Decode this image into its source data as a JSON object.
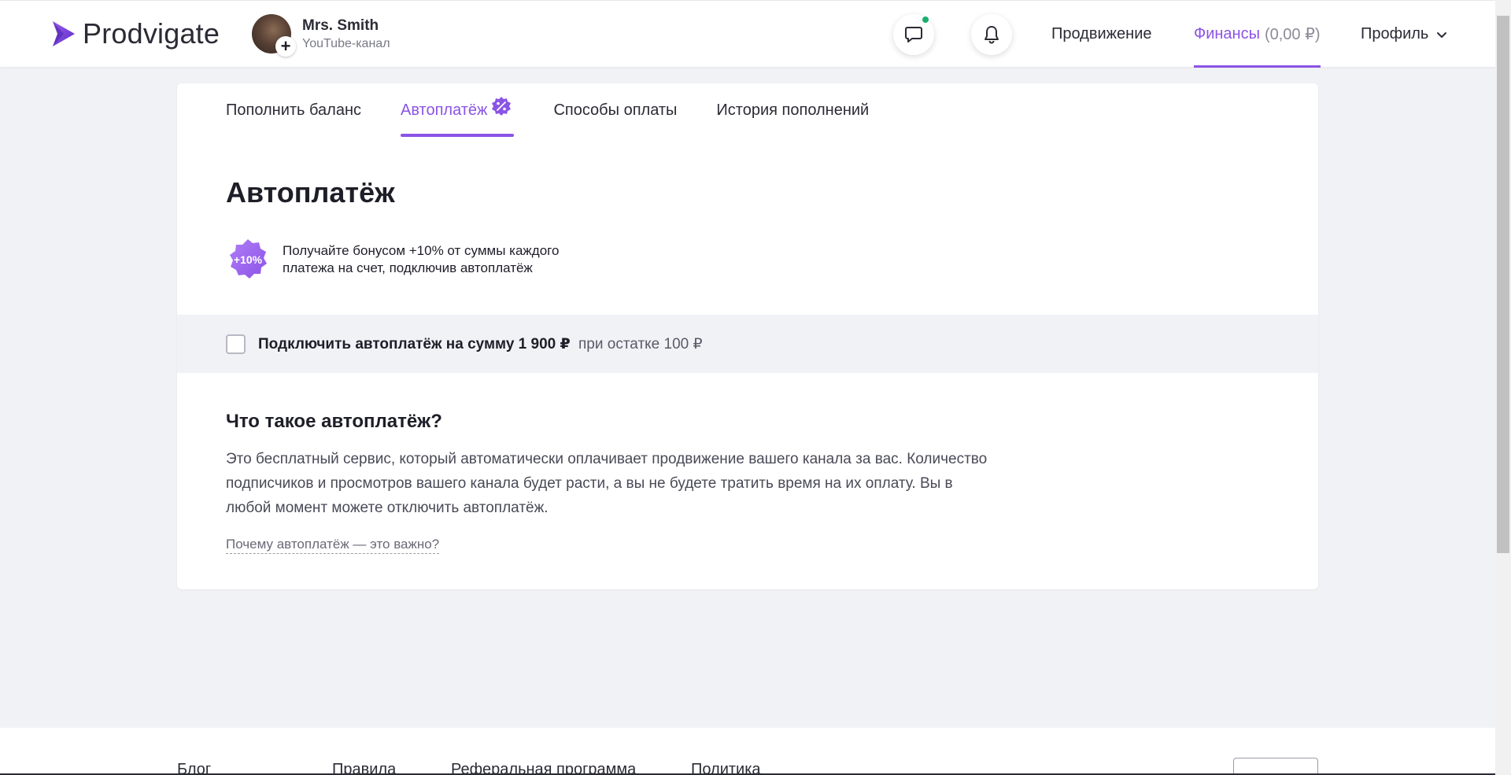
{
  "header": {
    "logo_text": "Prodvigate",
    "account": {
      "name": "Mrs. Smith",
      "type": "YouTube-канал",
      "add_symbol": "+"
    },
    "nav": {
      "promotion": "Продвижение",
      "finance": "Финансы",
      "finance_amount": "(0,00 ₽)",
      "profile": "Профиль"
    },
    "chat_has_unread": true
  },
  "tabs": [
    {
      "label": "Пополнить баланс",
      "active": false
    },
    {
      "label": "Автоплатёж",
      "active": true
    },
    {
      "label": "Способы оплаты",
      "active": false
    },
    {
      "label": "История пополнений",
      "active": false
    }
  ],
  "page": {
    "title": "Автоплатёж",
    "bonus_badge": "+10%",
    "bonus_text": "Получайте бонусом +10% от суммы каждого платежа на счет, подключив автоплатёж",
    "autopay": {
      "checked": false,
      "label_strong": "Подключить автоплатёж на сумму 1 900 ₽",
      "label_muted": "при остатке 100 ₽"
    },
    "faq_title": "Что такое автоплатёж?",
    "faq_text": "Это бесплатный сервис, который автоматически оплачивает продвижение вашего канала за вас. Количество подписчиков и просмотров вашего канала будет расти, а вы не будете тратить время на их оплату. Вы в любой момент можете отключить автоплатёж.",
    "faq_link": "Почему автоплатёж — это важно?"
  },
  "footer": {
    "links": [
      "Блог",
      "Правила",
      "Реферальная программа",
      "Политика"
    ]
  },
  "colors": {
    "accent": "#8a54e6",
    "online_dot": "#1aae6f",
    "background": "#f1f2f6"
  }
}
